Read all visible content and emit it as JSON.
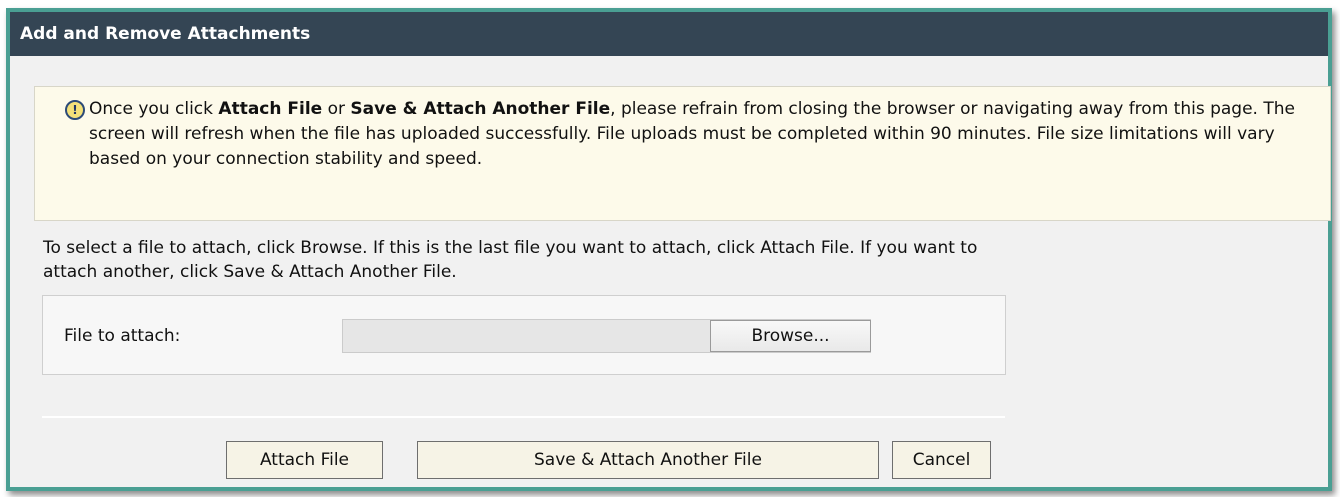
{
  "dialog": {
    "title": "Add and Remove Attachments"
  },
  "notice": {
    "icon": "info-exclamation-icon",
    "text_1": "Once you click ",
    "bold_1": "Attach File",
    "text_2": " or ",
    "bold_2": "Save & Attach Another File",
    "text_3": ", please refrain from closing the browser or navigating away from this page. The screen will refresh when the file has uploaded successfully. File uploads must be completed within 90 minutes. File size limitations will vary based on your connection stability and speed."
  },
  "instructions": {
    "text": "To select a file to attach, click Browse. If this is the last file you want to attach, click Attach File. If you want to attach another, click Save & Attach Another File."
  },
  "file_picker": {
    "label": "File to attach:",
    "value": "",
    "browse_label": "Browse..."
  },
  "actions": {
    "attach_label": "Attach File",
    "save_another_label": "Save & Attach Another File",
    "cancel_label": "Cancel"
  },
  "colors": {
    "titlebar": "#344554",
    "border": "#4a9f93",
    "notice_bg": "#fdfaea",
    "button_bg": "#f6f3e6"
  }
}
